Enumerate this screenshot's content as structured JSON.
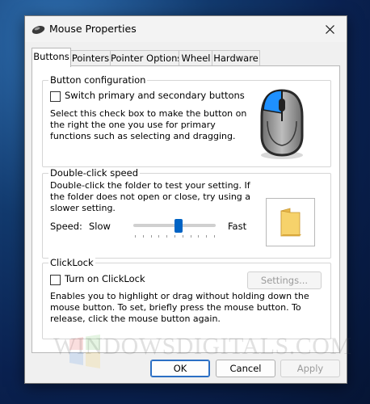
{
  "window": {
    "title": "Mouse Properties",
    "close_icon": "close-icon"
  },
  "tabs": [
    {
      "label": "Buttons",
      "active": true
    },
    {
      "label": "Pointers",
      "active": false
    },
    {
      "label": "Pointer Options",
      "active": false
    },
    {
      "label": "Wheel",
      "active": false
    },
    {
      "label": "Hardware",
      "active": false
    }
  ],
  "button_config": {
    "title": "Button configuration",
    "switch_label": "Switch primary and secondary buttons",
    "switch_checked": false,
    "description": "Select this check box to make the button on the right the one you use for primary functions such as selecting and dragging.",
    "image_icon": "mouse-icon"
  },
  "double_click": {
    "title": "Double-click speed",
    "description": "Double-click the folder to test your setting. If the folder does not open or close, try using a slower setting.",
    "speed_label": "Speed:",
    "slow_label": "Slow",
    "fast_label": "Fast",
    "slider_value_fraction": 0.55,
    "tick_count": 11,
    "folder_icon": "folder-icon"
  },
  "clicklock": {
    "title": "ClickLock",
    "toggle_label": "Turn on ClickLock",
    "toggle_checked": false,
    "settings_label": "Settings...",
    "settings_enabled": false,
    "description": "Enables you to highlight or drag without holding down the mouse button. To set, briefly press the mouse button. To release, click the mouse button again."
  },
  "footer": {
    "ok": "OK",
    "cancel": "Cancel",
    "apply": "Apply",
    "apply_enabled": false
  },
  "watermark": {
    "text": "WINDOWSDIGITALS.COM"
  },
  "colors": {
    "accent": "#0063c4",
    "mouse_button_highlight": "#1e90ff"
  }
}
